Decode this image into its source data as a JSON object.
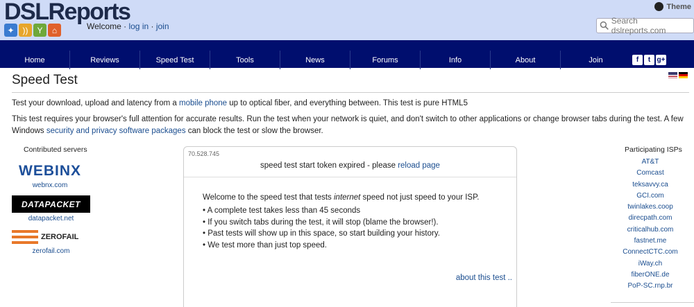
{
  "site": {
    "logo": "DSLReports",
    "welcome_prefix": "Welcome ·",
    "login": "log in",
    "dot": "·",
    "join": "join"
  },
  "theme": {
    "label": "Theme"
  },
  "search": {
    "placeholder": "Search dslreports.com"
  },
  "nav": [
    "Home",
    "Reviews",
    "Speed Test",
    "Tools",
    "News",
    "Forums",
    "Info",
    "About",
    "Join"
  ],
  "social": {
    "facebook": "f",
    "twitter": "t",
    "googleplus": "g+"
  },
  "page": {
    "title": "Speed Test",
    "p1_pre": "Test your download, upload and latency from a ",
    "p1_link": "mobile phone",
    "p1_post": " up to optical fiber, and everything between. This test is pure HTML5",
    "p2_pre": "This test requires your browser's full attention for accurate results. Run the test when your network is quiet, and don't switch to other applications or change browser tabs during the test. A few Windows ",
    "p2_link": "security and privacy software packages",
    "p2_post": " can block the test or slow the browser."
  },
  "contributed": {
    "title": "Contributed servers",
    "servers": [
      {
        "logo": "WEBINX",
        "label": "webnx.com"
      },
      {
        "logo": "DATAPACKET",
        "label": "datapacket.net"
      },
      {
        "logo": "ZEROFAIL",
        "label": "zerofail.com"
      }
    ]
  },
  "test_box": {
    "ip": "70.528.745",
    "token_text": "speed test start token expired - please ",
    "token_link": "reload page",
    "welcome_pre": "Welcome to the speed test that tests ",
    "welcome_em": "internet",
    "welcome_post": " speed not just speed to your ISP.",
    "bullets": [
      "• A complete test takes less than 45 seconds",
      "• If you switch tabs during the test, it will stop (blame the browser!).",
      "• Past tests will show up in this space, so start building your history.",
      "• We test more than just top speed."
    ],
    "about_link": "about this test .."
  },
  "isps": {
    "title": "Participating ISPs",
    "items": [
      "AT&T",
      "Comcast",
      "teksavvy.ca",
      "GCI.com",
      "twinlakes.coop",
      "direcpath.com",
      "criticalhub.com",
      "fastnet.me",
      "ConnectCTC.com",
      "iWay.ch",
      "fiberONE.de",
      "PoP-SC.rnp.br"
    ]
  },
  "colors": {
    "header_bg": "#cfdbf7",
    "nav_bg": "#000e6e",
    "link": "#1a4d8f"
  }
}
